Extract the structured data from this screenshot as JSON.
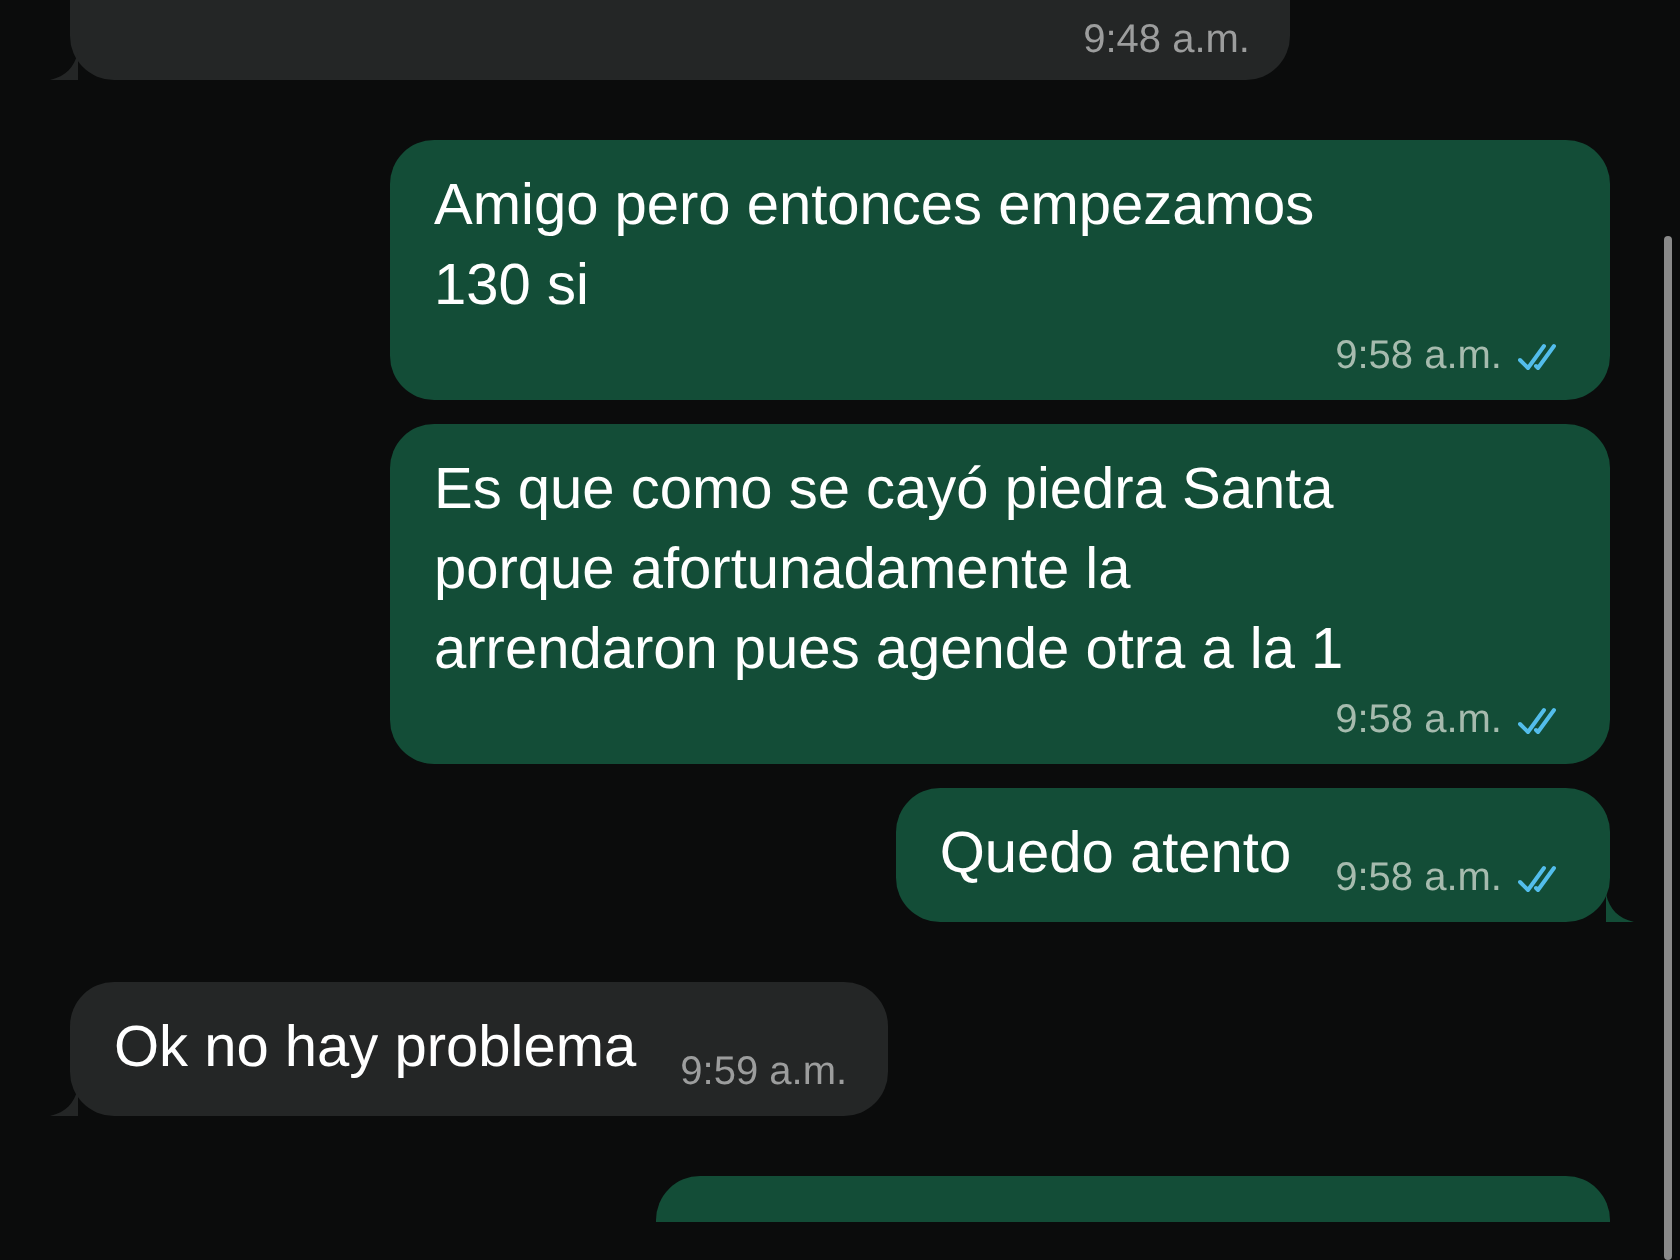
{
  "messages": [
    {
      "kind": "incoming",
      "partial": true,
      "time": "9:48 a.m.",
      "tail": true
    },
    {
      "kind": "outgoing",
      "partial": false,
      "text": "Amigo pero entonces empezamos\n130 si",
      "time": "9:58 a.m.",
      "read": true,
      "tail": false
    },
    {
      "kind": "outgoing",
      "partial": false,
      "text": "Es que como se cayó piedra Santa\nporque afortunadamente la\narrendaron pues agende otra a la 1",
      "time": "9:58 a.m.",
      "read": true,
      "tail": false
    },
    {
      "kind": "outgoing",
      "partial": false,
      "text": "Quedo atento",
      "time": "9:58 a.m.",
      "read": true,
      "tail": true
    },
    {
      "kind": "incoming",
      "partial": false,
      "text": "Ok no hay problema",
      "time": "9:59 a.m.",
      "tail": true
    },
    {
      "kind": "outgoing",
      "partial": true,
      "tail": false
    }
  ]
}
